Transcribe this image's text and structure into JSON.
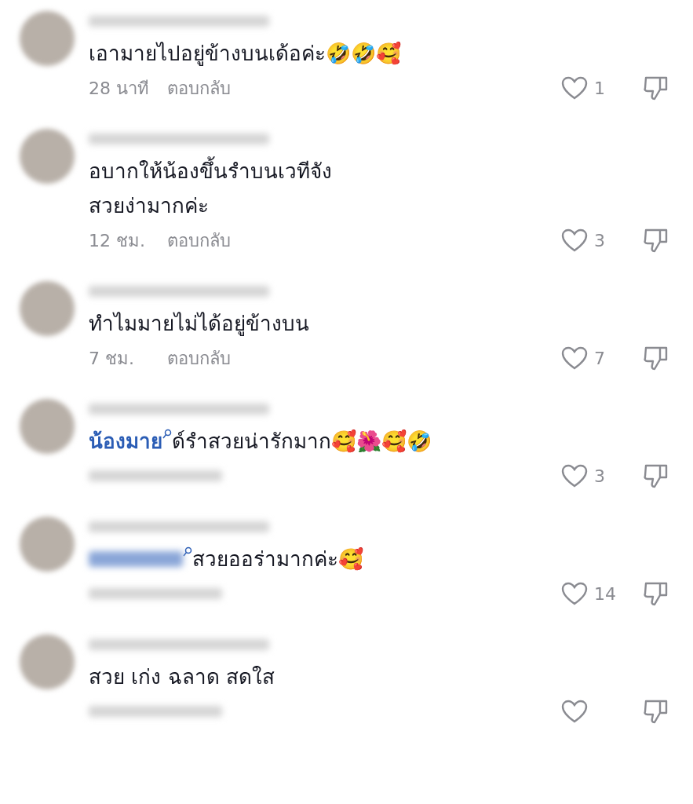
{
  "comments": [
    {
      "text": "เอามายไปอยู่ข้างบนเด้อค่ะ🤣🤣🥰",
      "meta_hidden": false,
      "time": "28 นาที",
      "reply": "ตอบกลับ",
      "likes": "1"
    },
    {
      "text": "อบากให้น้องขึ้นรำบนเวทีจัง\nสวยง่ามากค่ะ",
      "meta_hidden": false,
      "time": "12 ชม.",
      "reply": "ตอบกลับ",
      "likes": "3"
    },
    {
      "text": "ทำไมมายไม่ได้อยู่ข้างบน",
      "meta_hidden": false,
      "time": "7 ชม.",
      "reply": "ตอบกลับ",
      "likes": "7"
    },
    {
      "mention": "น้องมาย",
      "text": "ด์รำสวยน่ารักมาก🥰🌺🥰🤣",
      "meta_hidden": true,
      "likes": "3"
    },
    {
      "mention_hidden": true,
      "text": "สวยออร่ามากค่ะ🥰",
      "meta_hidden": true,
      "likes": "14"
    },
    {
      "text": "สวย เก่ง ฉลาด สดใส",
      "meta_hidden": true
    }
  ]
}
